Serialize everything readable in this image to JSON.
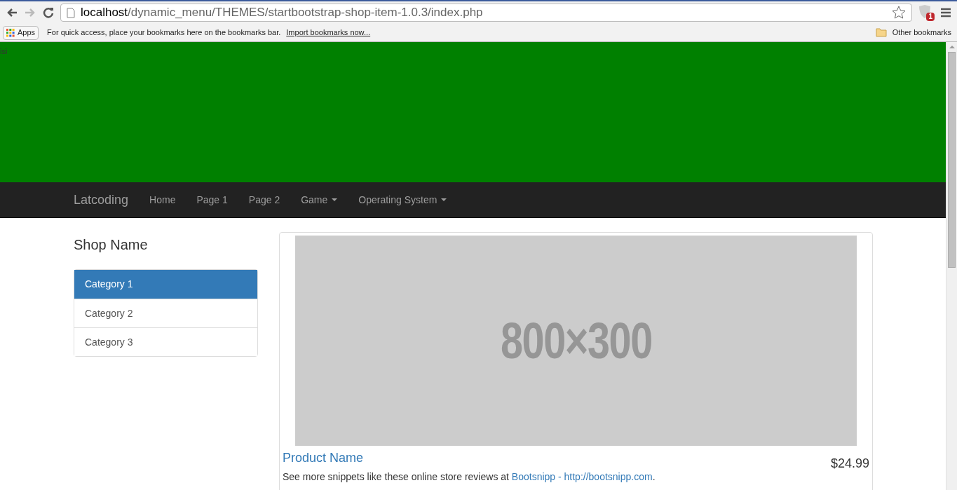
{
  "browser": {
    "url_host": "localhost",
    "url_path": "/dynamic_menu/THEMES/startbootstrap-shop-item-1.0.3/index.php",
    "extension_badge": "1",
    "bookmarks_bar": {
      "apps": "Apps",
      "hint": "For quick access, place your bookmarks here on the bookmarks bar.",
      "import_link": "Import bookmarks now...",
      "other": "Other bookmarks"
    }
  },
  "banner": {
    "text": "isi"
  },
  "navbar": {
    "brand": "Latcoding",
    "items": [
      {
        "label": "Home",
        "dropdown": false
      },
      {
        "label": "Page 1",
        "dropdown": false
      },
      {
        "label": "Page 2",
        "dropdown": false
      },
      {
        "label": "Game",
        "dropdown": true
      },
      {
        "label": "Operating System",
        "dropdown": true
      }
    ]
  },
  "sidebar": {
    "title": "Shop Name",
    "items": [
      {
        "label": "Category 1",
        "selected": true
      },
      {
        "label": "Category 2",
        "selected": false
      },
      {
        "label": "Category 3",
        "selected": false
      }
    ]
  },
  "product": {
    "image_text": "800×300",
    "name": "Product Name",
    "price": "$24.99",
    "description_prefix": "See more snippets like these online store reviews at ",
    "description_link": "Bootsnipp - http://bootsnipp.com",
    "description_suffix": "."
  }
}
